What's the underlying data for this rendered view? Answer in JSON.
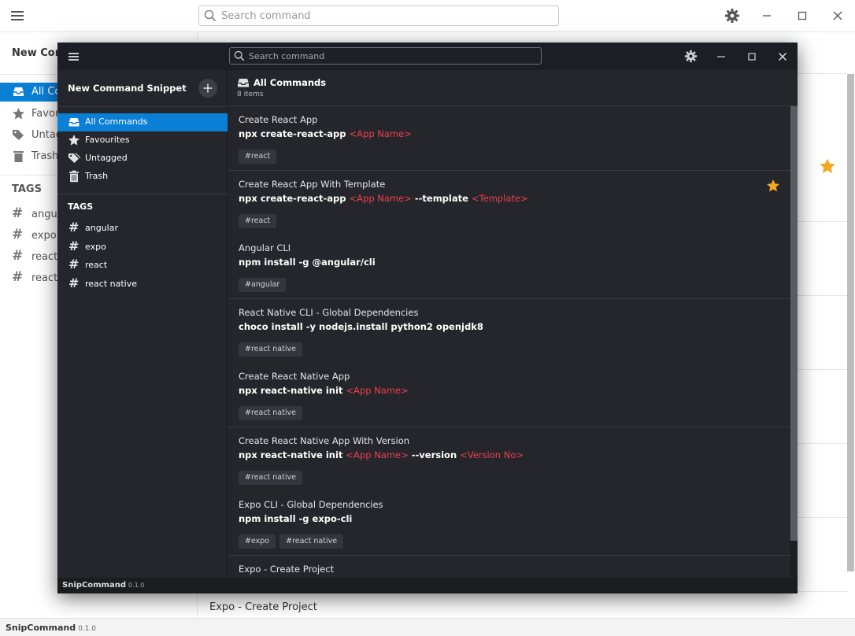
{
  "app": {
    "name": "SnipCommand",
    "version": "0.1.0"
  },
  "search": {
    "placeholder": "Search command"
  },
  "sidebar": {
    "new_button": "New Command Snippet",
    "nav": [
      {
        "label": "All Commands",
        "icon": "inbox-icon",
        "active": true
      },
      {
        "label": "Favourites",
        "icon": "star-icon",
        "active": false
      },
      {
        "label": "Untagged",
        "icon": "tags-icon",
        "active": false
      },
      {
        "label": "Trash",
        "icon": "trash-icon",
        "active": false
      }
    ],
    "tags_heading": "TAGS",
    "tags": [
      "angular",
      "expo",
      "react",
      "react native"
    ]
  },
  "main": {
    "title": "All Commands",
    "count": "8 items"
  },
  "commands": [
    {
      "title": "Create React App",
      "cmd": [
        [
          "npx create-react-app ",
          false
        ],
        [
          "<App Name>",
          true
        ]
      ],
      "tags": [
        "#react"
      ],
      "favourite": false
    },
    {
      "title": "Create React App With Template",
      "cmd": [
        [
          "npx create-react-app ",
          false
        ],
        [
          "<App Name>",
          true
        ],
        [
          " --template ",
          false
        ],
        [
          "<Template>",
          true
        ]
      ],
      "tags": [
        "#react"
      ],
      "favourite": true
    },
    {
      "title": "Angular CLI",
      "cmd": [
        [
          "npm install -g @angular/cli",
          false
        ]
      ],
      "tags": [
        "#angular"
      ],
      "favourite": false
    },
    {
      "title": "React Native CLI - Global Dependencies",
      "cmd": [
        [
          "choco install -y nodejs.install python2 openjdk8",
          false
        ]
      ],
      "tags": [
        "#react native"
      ],
      "favourite": false
    },
    {
      "title": "Create React Native App",
      "cmd": [
        [
          "npx react-native init ",
          false
        ],
        [
          "<App Name>",
          true
        ]
      ],
      "tags": [
        "#react native"
      ],
      "favourite": false
    },
    {
      "title": "Create React Native App With Version",
      "cmd": [
        [
          "npx react-native init ",
          false
        ],
        [
          "<App Name>",
          true
        ],
        [
          " --version ",
          false
        ],
        [
          "<Version No>",
          true
        ]
      ],
      "tags": [
        "#react native"
      ],
      "favourite": false
    },
    {
      "title": "Expo CLI - Global Dependencies",
      "cmd": [
        [
          "npm install -g expo-cli",
          false
        ]
      ],
      "tags": [
        "#expo",
        "#react native"
      ],
      "favourite": false
    },
    {
      "title": "Expo - Create Project",
      "cmd": [],
      "tags": [],
      "favourite": false
    }
  ],
  "background_window": {
    "search_placeholder": "Search command",
    "new_button": "New Com",
    "nav": [
      "All Co",
      "Favou",
      "Untag",
      "Trash"
    ],
    "tags_heading": "TAGS",
    "tags": [
      "angul",
      "expo",
      "react",
      "react"
    ],
    "last_row": "Expo - Create Project",
    "status_name": "SnipCommand",
    "status_version": "0.1.0"
  },
  "colors": {
    "accent": "#0a7fd6",
    "param": "#ee3f4d",
    "star": "#f5a623",
    "dark_bg": "#25262c"
  }
}
